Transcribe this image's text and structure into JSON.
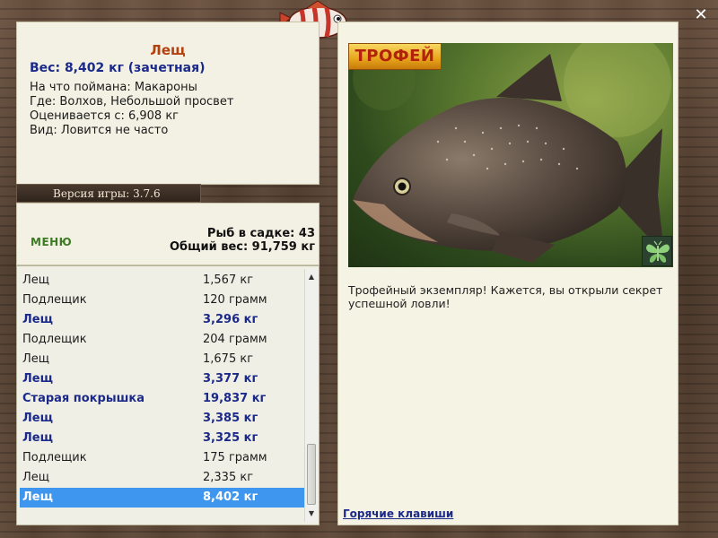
{
  "fish": {
    "title": "Лещ",
    "weight_line": "Вес: 8,402 кг (зачетная)",
    "bait_line": "На что поймана: Макароны",
    "location_line": "Где: Волхов, Небольшой просвет",
    "valued_line": "Оценивается с: 6,908 кг",
    "species_line": "Вид: Ловится не часто"
  },
  "version": "Версия игры: 3.7.6",
  "menu_label": "МЕНЮ",
  "stats": {
    "fish_in_keepnet": "Рыб в садке: 43",
    "total_weight": "Общий вес: 91,759 кг"
  },
  "catch_list": [
    {
      "name": "Лещ",
      "weight": "1,567 кг",
      "trophy": false
    },
    {
      "name": "Подлещик",
      "weight": "120 грамм",
      "trophy": false
    },
    {
      "name": "Лещ",
      "weight": "3,296 кг",
      "trophy": true
    },
    {
      "name": "Подлещик",
      "weight": "204 грамм",
      "trophy": false
    },
    {
      "name": "Лещ",
      "weight": "1,675 кг",
      "trophy": false
    },
    {
      "name": "Лещ",
      "weight": "3,377 кг",
      "trophy": true
    },
    {
      "name": "Старая покрышка",
      "weight": "19,837 кг",
      "trophy": true
    },
    {
      "name": "Лещ",
      "weight": "3,385 кг",
      "trophy": true
    },
    {
      "name": "Лещ",
      "weight": "3,325 кг",
      "trophy": true
    },
    {
      "name": "Подлещик",
      "weight": "175 грамм",
      "trophy": false
    },
    {
      "name": "Лещ",
      "weight": "2,335 кг",
      "trophy": false
    },
    {
      "name": "Лещ",
      "weight": "8,402 кг",
      "trophy": true,
      "selected": true
    }
  ],
  "trophy_badge": "ТРОФЕЙ",
  "trophy_message": "Трофейный экземпляр! Кажется, вы открыли секрет успешной ловли!",
  "hotkeys_link": "Горячие клавиши",
  "icons": {
    "close": "close-icon",
    "logo": "striped-fish-logo",
    "butterfly": "butterfly-icon",
    "scroll_up": "chevron-up-icon",
    "scroll_down": "chevron-down-icon"
  },
  "colors": {
    "title": "#b3400f",
    "trophy_text": "#1b2a8a",
    "menu": "#3c7a24",
    "selected_row": "#3f96ee",
    "panel": "#f3f1e3"
  }
}
